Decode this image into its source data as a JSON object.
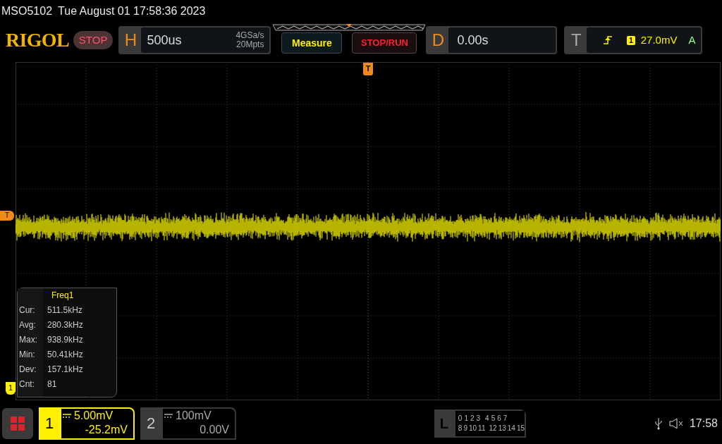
{
  "header": {
    "model": "MSO5102",
    "datetime": "Tue August 01 17:58:36 2023"
  },
  "toolbar": {
    "logo": "RIGOL",
    "run_state": "STOP",
    "horizontal": {
      "label": "H",
      "timebase": "500us",
      "sample_rate": "4GSa/s",
      "memory_depth": "20Mpts"
    },
    "measure_button": "Measure",
    "stop_run_button": "STOP/RUN",
    "delay": {
      "label": "D",
      "value": "0.00s"
    },
    "trigger": {
      "label": "T",
      "source": "1",
      "level": "27.0mV",
      "mode": "A"
    }
  },
  "graticule": {
    "trigger_position_marker": "T",
    "trigger_level_marker": "T",
    "channel_marker": "1"
  },
  "measurement": {
    "title": "Freq1",
    "rows": [
      {
        "label": "Cur:",
        "value": "511.5kHz"
      },
      {
        "label": "Avg:",
        "value": "280.3kHz"
      },
      {
        "label": "Max:",
        "value": "938.9kHz"
      },
      {
        "label": "Min:",
        "value": "50.41kHz"
      },
      {
        "label": "Dev:",
        "value": "157.1kHz"
      },
      {
        "label": "Cnt:",
        "value": "81"
      }
    ]
  },
  "channels": [
    {
      "number": "1",
      "scale": "5.00mV",
      "offset": "-25.2mV",
      "selected": true
    },
    {
      "number": "2",
      "scale": "100mV",
      "offset": "0.00V",
      "selected": false
    }
  ],
  "logic": {
    "label": "L",
    "row_1": [
      "0",
      "1",
      "2",
      "3",
      "4",
      "5",
      "6",
      "7"
    ],
    "row_2": [
      "8",
      "9",
      "10",
      "11",
      "12",
      "13",
      "14",
      "15"
    ]
  },
  "status": {
    "clock": "17:58"
  }
}
